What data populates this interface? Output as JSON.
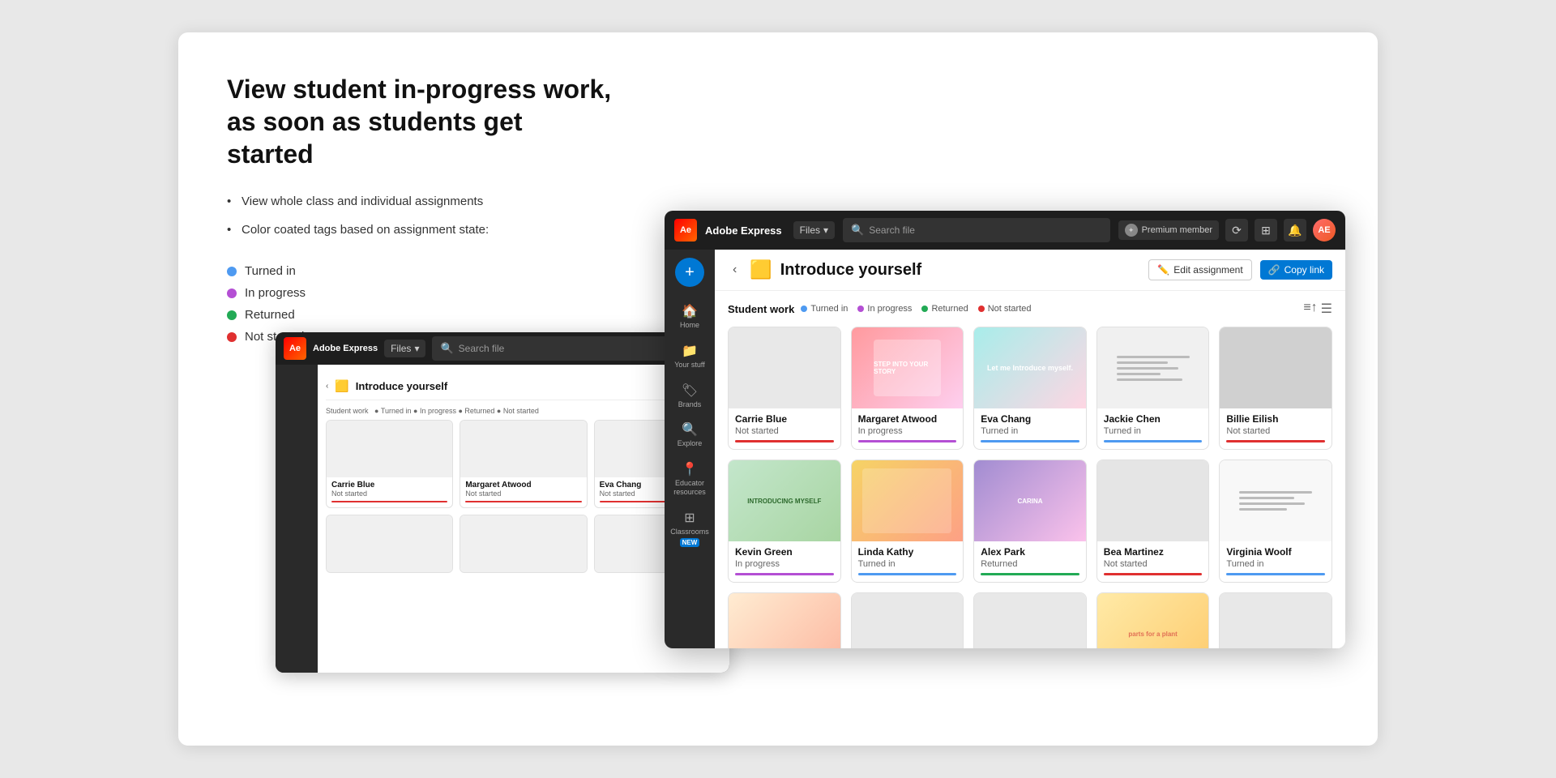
{
  "page": {
    "heading_line1": "View student in-progress work,",
    "heading_line2": "as soon as students get started"
  },
  "bullets": [
    {
      "text": "View whole class and individual assignments"
    },
    {
      "text": "Color coated tags based on assignment state:"
    }
  ],
  "tags": [
    {
      "label": "Turned in",
      "color": "#4e9af1"
    },
    {
      "label": "In progress",
      "color": "#b44fd4"
    },
    {
      "label": "Returned",
      "color": "#22aa55"
    },
    {
      "label": "Not started",
      "color": "#e03030"
    }
  ],
  "topbar": {
    "brand": "Adobe Express",
    "dropdown": "Files",
    "search_placeholder": "Search file",
    "premium_label": "Premium member",
    "icons": [
      "refresh-icon",
      "grid-icon",
      "bell-icon"
    ],
    "avatar_initials": "AE"
  },
  "sidebar": {
    "add_label": "+",
    "items": [
      {
        "label": "Home",
        "icon": "🏠"
      },
      {
        "label": "Your stuff",
        "icon": "📁"
      },
      {
        "label": "Brands",
        "icon": "🏷"
      },
      {
        "label": "Explore",
        "icon": "🔍"
      },
      {
        "label": "Educator resources",
        "icon": "📍"
      },
      {
        "label": "Classrooms",
        "icon": "⊞",
        "badge": "NEW"
      }
    ]
  },
  "assignment": {
    "icon": "🟨",
    "title": "Introduce yourself",
    "edit_label": "Edit assignment",
    "copy_link_label": "Copy link"
  },
  "student_work": {
    "section_title": "Student work",
    "legend": [
      {
        "label": "Turned in",
        "color": "#4e9af1"
      },
      {
        "label": "In progress",
        "color": "#b44fd4"
      },
      {
        "label": "Returned",
        "color": "#22aa55"
      },
      {
        "label": "Not started",
        "color": "#e03030"
      }
    ],
    "students_row1": [
      {
        "name": "Carrie Blue",
        "status": "Not started",
        "status_color": "#e03030",
        "thumb_class": "thumb-blank"
      },
      {
        "name": "Margaret Atwood",
        "status": "In progress",
        "status_color": "#b44fd4",
        "thumb_class": "thumb-pink"
      },
      {
        "name": "Eva Chang",
        "status": "Turned in",
        "status_color": "#4e9af1",
        "thumb_class": "thumb-blue-intro"
      },
      {
        "name": "Jackie Chen",
        "status": "Turned in",
        "status_color": "#4e9af1",
        "thumb_class": "thumb-worksheet"
      },
      {
        "name": "Billie Eilish",
        "status": "Not started",
        "status_color": "#e03030",
        "thumb_class": "thumb-gray"
      }
    ],
    "students_row2": [
      {
        "name": "Kevin Green",
        "status": "In progress",
        "status_color": "#b44fd4",
        "thumb_class": "thumb-green-intro"
      },
      {
        "name": "Linda Kathy",
        "status": "Turned in",
        "status_color": "#4e9af1",
        "thumb_class": "thumb-orange"
      },
      {
        "name": "Alex Park",
        "status": "Returned",
        "status_color": "#22aa55",
        "thumb_class": "thumb-purple"
      },
      {
        "name": "Bea Martinez",
        "status": "Not started",
        "status_color": "#e03030",
        "thumb_class": "thumb-light-gray"
      },
      {
        "name": "Virginia Woolf",
        "status": "Turned in",
        "status_color": "#4e9af1",
        "thumb_class": "thumb-worksheet2"
      }
    ],
    "students_row3": [
      {
        "name": "",
        "status": "",
        "status_color": "#e0e0e0",
        "thumb_class": "thumb-warm"
      },
      {
        "name": "",
        "status": "",
        "status_color": "#e0e0e0",
        "thumb_class": "thumb-blank"
      },
      {
        "name": "",
        "status": "",
        "status_color": "#e0e0e0",
        "thumb_class": "thumb-blank"
      },
      {
        "name": "",
        "status": "",
        "status_color": "#e0e0e0",
        "thumb_class": "thumb-animal"
      },
      {
        "name": "",
        "status": "",
        "status_color": "#e0e0e0",
        "thumb_class": "thumb-blank"
      }
    ]
  },
  "bg_students": [
    {
      "name": "Carrie Blue",
      "status": "Not started",
      "status_color": "#e03030"
    },
    {
      "name": "Margaret Atwood",
      "status": "Not started",
      "status_color": "#e03030"
    },
    {
      "name": "Eva Chang",
      "status": "Not started",
      "status_color": "#e03030"
    }
  ]
}
